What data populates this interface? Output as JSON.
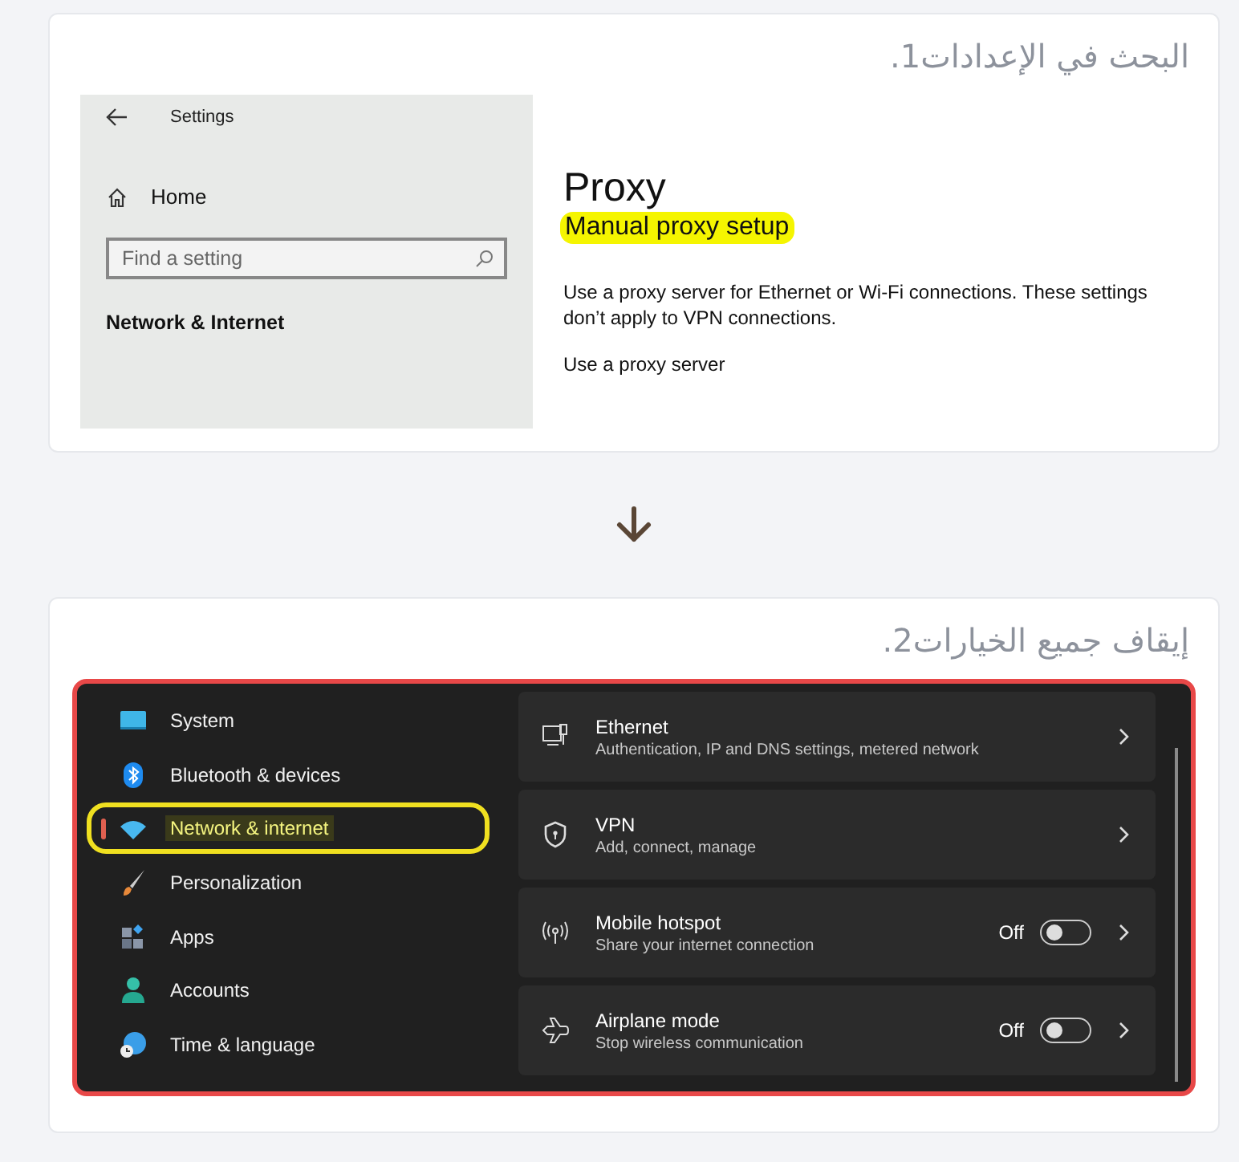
{
  "step1": {
    "title": ".1البحث في الإعدادات",
    "window_title": "Settings",
    "home": "Home",
    "search": {
      "placeholder": "Find a setting"
    },
    "section": "Network & Internet",
    "heading": "Proxy",
    "subheading": "Manual proxy setup",
    "description": "Use a proxy server for Ethernet or Wi-Fi connections. These settings don’t apply to VPN connections.",
    "cut_line": "Use a proxy server"
  },
  "step2": {
    "title": ".2إيقاف جميع الخيارات",
    "nav": [
      {
        "label": "System",
        "selected": false
      },
      {
        "label": "Bluetooth & devices",
        "selected": false
      },
      {
        "label": "Network & internet",
        "selected": true
      },
      {
        "label": "Personalization",
        "selected": false
      },
      {
        "label": "Apps",
        "selected": false
      },
      {
        "label": "Accounts",
        "selected": false
      },
      {
        "label": "Time & language",
        "selected": false
      }
    ],
    "rows": [
      {
        "title": "Ethernet",
        "subtitle": "Authentication, IP and DNS settings, metered network"
      },
      {
        "title": "VPN",
        "subtitle": "Add, connect, manage"
      },
      {
        "title": "Mobile hotspot",
        "subtitle": "Share your internet connection",
        "toggle": {
          "label": "Off",
          "on": false
        }
      },
      {
        "title": "Airplane mode",
        "subtitle": "Stop wireless communication",
        "toggle": {
          "label": "Off",
          "on": false
        }
      }
    ]
  }
}
